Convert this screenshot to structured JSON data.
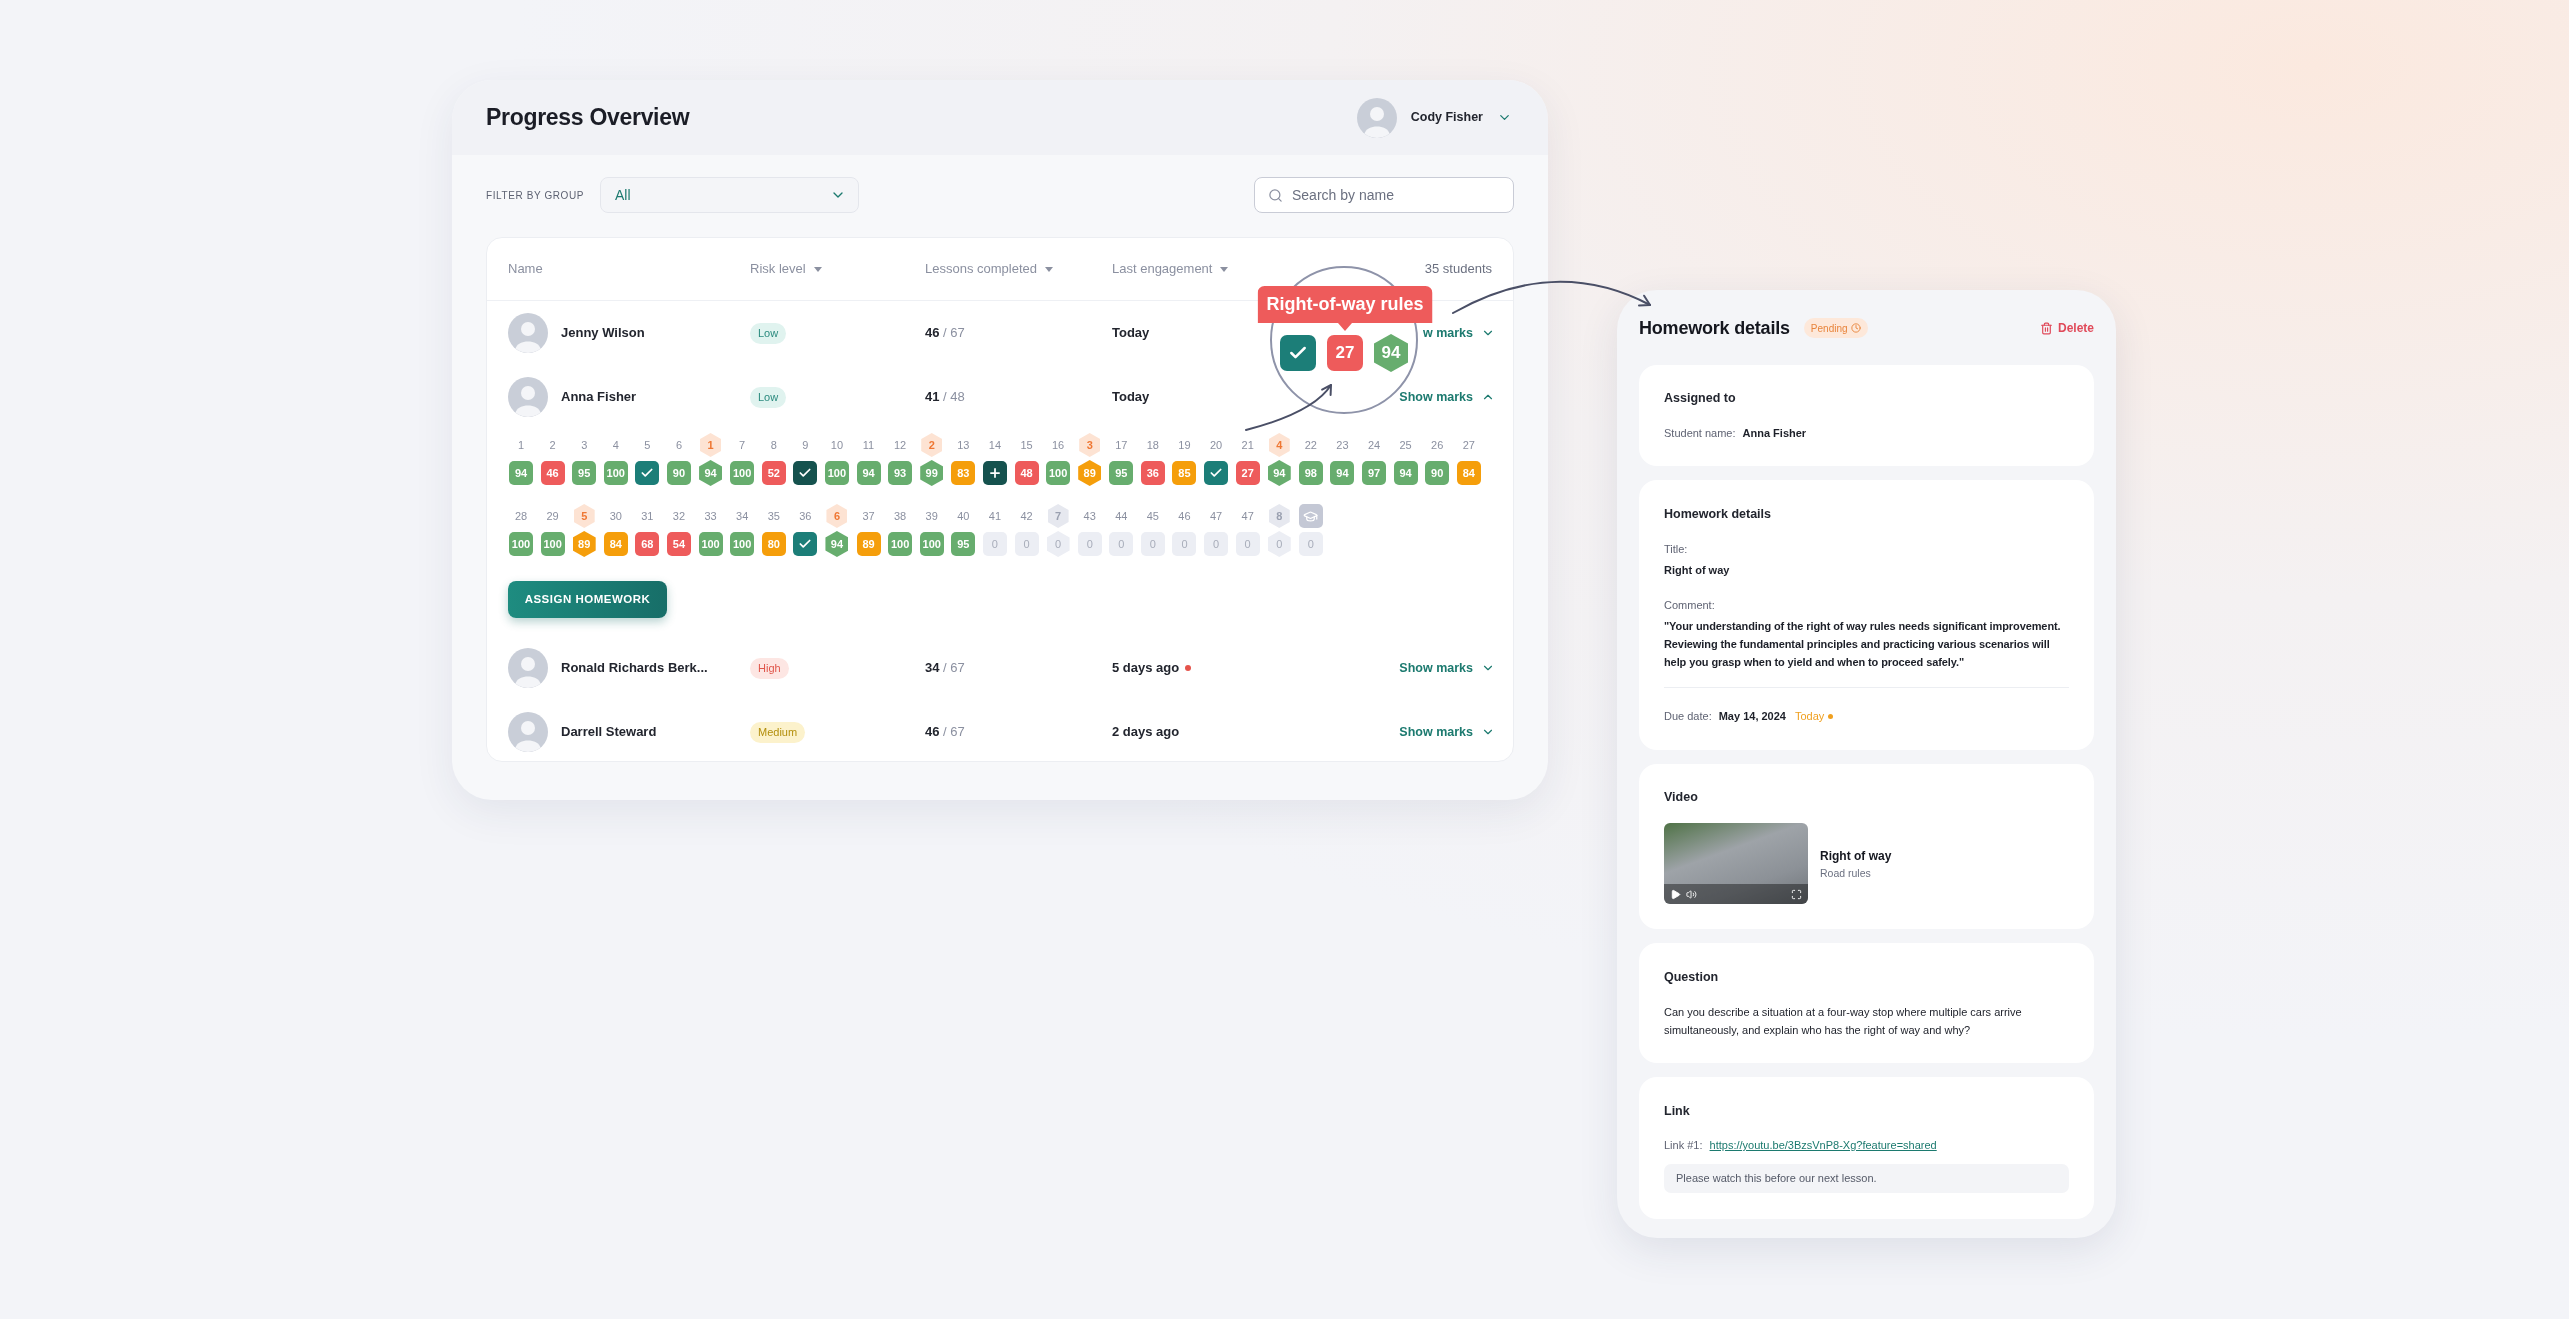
{
  "progress": {
    "title": "Progress Overview",
    "user": {
      "name": "Cody Fisher"
    },
    "filter": {
      "label": "FILTER BY GROUP",
      "value": "All"
    },
    "search": {
      "placeholder": "Search by name"
    },
    "table": {
      "columns": [
        {
          "label": "Name",
          "sortable": false
        },
        {
          "label": "Risk level",
          "sortable": true
        },
        {
          "label": "Lessons completed",
          "sortable": true
        },
        {
          "label": "Last engagement",
          "sortable": true
        }
      ],
      "count": "35 students",
      "students": [
        {
          "name": "Jenny Wilson",
          "risk": {
            "label": "Low",
            "kind": "low"
          },
          "lessons": "**46** / 67",
          "last_engagement": "Today",
          "alert": false,
          "show_marks": "w marks",
          "expanded": false
        },
        {
          "name": "Anna Fisher",
          "risk": {
            "label": "Low",
            "kind": "low"
          },
          "lessons": "**41** / 48",
          "last_engagement": "Today",
          "alert": false,
          "show_marks": "Show marks",
          "expanded": true,
          "assign_button": "ASSIGN HOMEWORK",
          "mark_rows": [
            [
              {
                "label": "1",
                "kind": "lesson",
                "mark": {
                  "kind": "score",
                  "value": "94",
                  "color": "#67ad6e"
                }
              },
              {
                "label": "2",
                "kind": "lesson",
                "mark": {
                  "kind": "score",
                  "value": "46",
                  "color": "#ee5b5b"
                }
              },
              {
                "label": "3",
                "kind": "lesson",
                "mark": {
                  "kind": "score",
                  "value": "95",
                  "color": "#67ad6e"
                }
              },
              {
                "label": "4",
                "kind": "lesson",
                "mark": {
                  "kind": "score",
                  "value": "100",
                  "color": "#67ad6e"
                }
              },
              {
                "label": "5",
                "kind": "lesson",
                "mark": {
                  "kind": "check",
                  "color": "#1c7e78"
                }
              },
              {
                "label": "6",
                "kind": "lesson",
                "mark": {
                  "kind": "score",
                  "value": "90",
                  "color": "#67ad6e"
                }
              },
              {
                "label": "1",
                "kind": "test",
                "mark": {
                  "kind": "score",
                  "value": "94",
                  "color": "#67ad6e"
                }
              },
              {
                "label": "7",
                "kind": "lesson",
                "mark": {
                  "kind": "score",
                  "value": "100",
                  "color": "#67ad6e"
                }
              },
              {
                "label": "8",
                "kind": "lesson",
                "mark": {
                  "kind": "score",
                  "value": "52",
                  "color": "#ee5b5b"
                }
              },
              {
                "label": "9",
                "kind": "lesson",
                "mark": {
                  "kind": "check",
                  "color": "#15524e"
                }
              },
              {
                "label": "10",
                "kind": "lesson",
                "mark": {
                  "kind": "score",
                  "value": "100",
                  "color": "#67ad6e"
                }
              },
              {
                "label": "11",
                "kind": "lesson",
                "mark": {
                  "kind": "score",
                  "value": "94",
                  "color": "#67ad6e"
                }
              },
              {
                "label": "12",
                "kind": "lesson",
                "mark": {
                  "kind": "score",
                  "value": "93",
                  "color": "#67ad6e"
                }
              },
              {
                "label": "2",
                "kind": "test",
                "mark": {
                  "kind": "score",
                  "value": "99",
                  "color": "#67ad6e"
                }
              },
              {
                "label": "13",
                "kind": "lesson",
                "mark": {
                  "kind": "score",
                  "value": "83",
                  "color": "#f59e0b"
                }
              },
              {
                "label": "14",
                "kind": "lesson",
                "mark": {
                  "kind": "plus",
                  "color": "#15524e"
                }
              },
              {
                "label": "15",
                "kind": "lesson",
                "mark": {
                  "kind": "score",
                  "value": "48",
                  "color": "#ee5b5b"
                }
              },
              {
                "label": "16",
                "kind": "lesson",
                "mark": {
                  "kind": "score",
                  "value": "100",
                  "color": "#67ad6e"
                }
              },
              {
                "label": "3",
                "kind": "test",
                "mark": {
                  "kind": "score",
                  "value": "89",
                  "color": "#f59e0b"
                }
              },
              {
                "label": "17",
                "kind": "lesson",
                "mark": {
                  "kind": "score",
                  "value": "95",
                  "color": "#67ad6e"
                }
              },
              {
                "label": "18",
                "kind": "lesson",
                "mark": {
                  "kind": "score",
                  "value": "36",
                  "color": "#ee5b5b"
                }
              },
              {
                "label": "19",
                "kind": "lesson",
                "mark": {
                  "kind": "score",
                  "value": "85",
                  "color": "#f59e0b"
                }
              },
              {
                "label": "20",
                "kind": "lesson",
                "mark": {
                  "kind": "check",
                  "color": "#1c7e78"
                }
              },
              {
                "label": "21",
                "kind": "lesson",
                "mark": {
                  "kind": "score",
                  "value": "27",
                  "color": "#ee5b5b"
                }
              },
              {
                "label": "4",
                "kind": "test",
                "mark": {
                  "kind": "score",
                  "value": "94",
                  "color": "#67ad6e"
                }
              },
              {
                "label": "22",
                "kind": "lesson",
                "mark": {
                  "kind": "score",
                  "value": "98",
                  "color": "#67ad6e"
                }
              },
              {
                "label": "23",
                "kind": "lesson",
                "mark": {
                  "kind": "score",
                  "value": "94",
                  "color": "#67ad6e"
                }
              },
              {
                "label": "24",
                "kind": "lesson",
                "mark": {
                  "kind": "score",
                  "value": "97",
                  "color": "#67ad6e"
                }
              },
              {
                "label": "25",
                "kind": "lesson",
                "mark": {
                  "kind": "score",
                  "value": "94",
                  "color": "#67ad6e"
                }
              },
              {
                "label": "26",
                "kind": "lesson",
                "mark": {
                  "kind": "score",
                  "value": "90",
                  "color": "#67ad6e"
                }
              },
              {
                "label": "27",
                "kind": "lesson",
                "mark": {
                  "kind": "score",
                  "value": "84",
                  "color": "#f59e0b"
                }
              }
            ],
            [
              {
                "label": "28",
                "kind": "lesson",
                "mark": {
                  "kind": "score",
                  "value": "100",
                  "color": "#67ad6e"
                }
              },
              {
                "label": "29",
                "kind": "lesson",
                "mark": {
                  "kind": "score",
                  "value": "100",
                  "color": "#67ad6e"
                }
              },
              {
                "label": "5",
                "kind": "test",
                "mark": {
                  "kind": "score",
                  "value": "89",
                  "color": "#f59e0b"
                }
              },
              {
                "label": "30",
                "kind": "lesson",
                "mark": {
                  "kind": "score",
                  "value": "84",
                  "color": "#f59e0b"
                }
              },
              {
                "label": "31",
                "kind": "lesson",
                "mark": {
                  "kind": "score",
                  "value": "68",
                  "color": "#ee5b5b"
                }
              },
              {
                "label": "32",
                "kind": "lesson",
                "mark": {
                  "kind": "score",
                  "value": "54",
                  "color": "#ee5b5b"
                }
              },
              {
                "label": "33",
                "kind": "lesson",
                "mark": {
                  "kind": "score",
                  "value": "100",
                  "color": "#67ad6e"
                }
              },
              {
                "label": "34",
                "kind": "lesson",
                "mark": {
                  "kind": "score",
                  "value": "100",
                  "color": "#67ad6e"
                }
              },
              {
                "label": "35",
                "kind": "lesson",
                "mark": {
                  "kind": "score",
                  "value": "80",
                  "color": "#f59e0b"
                }
              },
              {
                "label": "36",
                "kind": "lesson",
                "mark": {
                  "kind": "check",
                  "color": "#1c7e78"
                }
              },
              {
                "label": "6",
                "kind": "test",
                "mark": {
                  "kind": "score",
                  "value": "94",
                  "color": "#67ad6e"
                }
              },
              {
                "label": "37",
                "kind": "lesson",
                "mark": {
                  "kind": "score",
                  "value": "89",
                  "color": "#f59e0b"
                }
              },
              {
                "label": "38",
                "kind": "lesson",
                "mark": {
                  "kind": "score",
                  "value": "100",
                  "color": "#67ad6e"
                }
              },
              {
                "label": "39",
                "kind": "lesson",
                "mark": {
                  "kind": "score",
                  "value": "100",
                  "color": "#67ad6e"
                }
              },
              {
                "label": "40",
                "kind": "lesson",
                "mark": {
                  "kind": "score",
                  "value": "95",
                  "color": "#67ad6e"
                }
              },
              {
                "label": "41",
                "kind": "lesson",
                "mark": {
                  "kind": "empty",
                  "value": "0"
                }
              },
              {
                "label": "42",
                "kind": "lesson",
                "mark": {
                  "kind": "empty",
                  "value": "0"
                }
              },
              {
                "label": "7",
                "kind": "locked_test",
                "mark": {
                  "kind": "empty",
                  "value": "0"
                }
              },
              {
                "label": "43",
                "kind": "lesson",
                "mark": {
                  "kind": "empty",
                  "value": "0"
                }
              },
              {
                "label": "44",
                "kind": "lesson",
                "mark": {
                  "kind": "empty",
                  "value": "0"
                }
              },
              {
                "label": "45",
                "kind": "lesson",
                "mark": {
                  "kind": "empty",
                  "value": "0"
                }
              },
              {
                "label": "46",
                "kind": "lesson",
                "mark": {
                  "kind": "empty",
                  "value": "0"
                }
              },
              {
                "label": "47",
                "kind": "lesson",
                "mark": {
                  "kind": "empty",
                  "value": "0"
                }
              },
              {
                "label": "47",
                "kind": "lesson",
                "mark": {
                  "kind": "empty",
                  "value": "0"
                }
              },
              {
                "label": "8",
                "kind": "locked_test",
                "mark": {
                  "kind": "empty",
                  "value": "0"
                }
              },
              {
                "kind": "final",
                "mark": {
                  "kind": "empty",
                  "value": "0"
                }
              }
            ]
          ]
        },
        {
          "name": "Ronald Richards Berk...",
          "risk": {
            "label": "High",
            "kind": "high"
          },
          "lessons": "**34** / 67",
          "last_engagement": "5 days ago",
          "alert": true,
          "show_marks": "Show marks",
          "expanded": false
        },
        {
          "name": "Darrell Steward",
          "risk": {
            "label": "Medium",
            "kind": "medium"
          },
          "lessons": "**46** / 67",
          "last_engagement": "2 days ago",
          "alert": false,
          "show_marks": "Show marks",
          "expanded": false
        }
      ]
    }
  },
  "magnifier": {
    "tooltip": "Right-of-way rules",
    "marks": [
      {
        "kind": "lesson",
        "mark": {
          "kind": "check",
          "color": "#1c7e78"
        }
      },
      {
        "kind": "lesson",
        "mark": {
          "kind": "score",
          "value": "27",
          "color": "#ee5b5b"
        }
      },
      {
        "kind": "test",
        "mark": {
          "kind": "score",
          "value": "94",
          "color": "#67ad6e"
        }
      }
    ]
  },
  "homework": {
    "title": "Homework details",
    "status": "Pending",
    "delete": "Delete",
    "assigned": {
      "title": "Assigned to",
      "label": "Student name:",
      "value": "Anna Fisher"
    },
    "details": {
      "title": "Homework details",
      "title_label": "Title:",
      "title_value": "Right of way",
      "comment_label": "Comment:",
      "comment": "\"Your understanding of the right of way rules needs significant improvement. Reviewing the fundamental principles and practicing various scenarios will help you grasp when to yield and when to proceed safely.\"",
      "due_label": "Due date:",
      "due_value": "May 14, 2024",
      "due_tag": "Today"
    },
    "video": {
      "title": "Video",
      "name": "Right of way",
      "category": "Road rules"
    },
    "question": {
      "title": "Question",
      "text": "Can you describe a situation at a four-way stop where multiple cars arrive simultaneously, and explain who has the right of way and why?"
    },
    "link": {
      "title": "Link",
      "label": "Link #1:",
      "url": "https://youtu.be/3BzsVnP8-Xg?feature=shared",
      "note": "Please watch this before our next lesson."
    }
  }
}
